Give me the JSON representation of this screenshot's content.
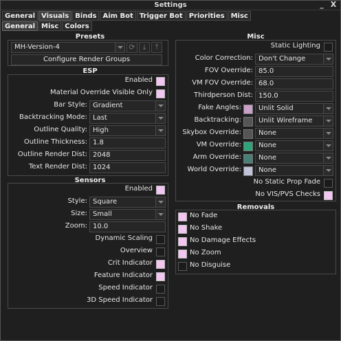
{
  "window": {
    "title": "Settings",
    "min_label": "_",
    "close_label": "X"
  },
  "tabs": [
    "General",
    "Visuals",
    "Binds",
    "Aim Bot",
    "Trigger Bot",
    "Priorities",
    "Misc"
  ],
  "subtabs": [
    "General",
    "Misc",
    "Colors"
  ],
  "presets": {
    "title": "Presets",
    "selected": "MH-Version-4",
    "configure_label": "Configure Render Groups",
    "icons": [
      "refresh-icon",
      "download-icon",
      "upload-icon"
    ]
  },
  "esp": {
    "title": "ESP",
    "checks": [
      {
        "label": "Enabled",
        "on": true
      },
      {
        "label": "Material Override Visible Only",
        "on": true
      }
    ],
    "fields": [
      {
        "label": "Bar Style:",
        "value": "Gradient",
        "dropdown": true
      },
      {
        "label": "Backtracking Mode:",
        "value": "Last",
        "dropdown": true
      },
      {
        "label": "Outline Quality:",
        "value": "High",
        "dropdown": true
      },
      {
        "label": "Outline Thickness:",
        "value": "1.8",
        "dropdown": false
      },
      {
        "label": "Outline Render Dist:",
        "value": "2048",
        "dropdown": false
      },
      {
        "label": "Text Render Dist:",
        "value": "1024",
        "dropdown": false
      }
    ]
  },
  "sensors": {
    "title": "Sensors",
    "enabled": {
      "label": "Enabled",
      "on": true
    },
    "fields": [
      {
        "label": "Style:",
        "value": "Square",
        "dropdown": true
      },
      {
        "label": "Size:",
        "value": "Small",
        "dropdown": true
      },
      {
        "label": "Zoom:",
        "value": "10.0",
        "dropdown": false
      }
    ],
    "checks": [
      {
        "label": "Dynamic Scaling",
        "on": false
      },
      {
        "label": "Overview",
        "on": false
      },
      {
        "label": "Crit Indicator",
        "on": true
      },
      {
        "label": "Feature Indicator",
        "on": true
      },
      {
        "label": "Speed Indicator",
        "on": false
      },
      {
        "label": "3D Speed Indicator",
        "on": false
      }
    ]
  },
  "misc": {
    "title": "Misc",
    "static_lighting": {
      "label": "Static Lighting",
      "on": false
    },
    "fields": [
      {
        "label": "Color Correction:",
        "value": "Don't Change",
        "dropdown": true
      },
      {
        "label": "FOV Override:",
        "value": "85.0",
        "dropdown": false
      },
      {
        "label": "VM FOV Override:",
        "value": "68.0",
        "dropdown": false
      },
      {
        "label": "Thirdperson Dist:",
        "value": "150.0",
        "dropdown": false
      }
    ],
    "materials": [
      {
        "label": "Fake Angles:",
        "value": "Unlit Solid",
        "color": "#c8a0c8"
      },
      {
        "label": "Backtracking:",
        "value": "Unlit Wireframe",
        "color": "#555555"
      },
      {
        "label": "Skybox Override:",
        "value": "None",
        "color": "#555555"
      },
      {
        "label": "VM Override:",
        "value": "None",
        "color": "#2fa37a"
      },
      {
        "label": "Arm Override:",
        "value": "None",
        "color": "#4a7f78"
      },
      {
        "label": "World Override:",
        "value": "None",
        "color": "#c0c4d8"
      }
    ],
    "checks": [
      {
        "label": "No Static Prop Fade",
        "on": false
      },
      {
        "label": "No VIS/PVS Checks",
        "on": true
      }
    ]
  },
  "removals": {
    "title": "Removals",
    "items": [
      {
        "label": "No Fade",
        "on": true
      },
      {
        "label": "No Shake",
        "on": true
      },
      {
        "label": "No Damage Effects",
        "on": true
      },
      {
        "label": "No Zoom",
        "on": true
      },
      {
        "label": "No Disguise",
        "on": false
      }
    ]
  }
}
